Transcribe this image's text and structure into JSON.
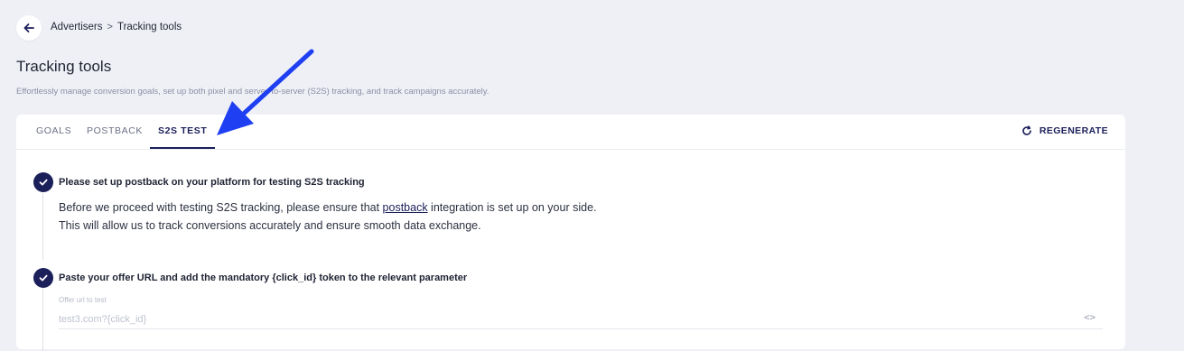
{
  "breadcrumb": {
    "parent": "Advertisers",
    "separator": ">",
    "current": "Tracking tools"
  },
  "page": {
    "title": "Tracking tools",
    "subtitle": "Effortlessly manage conversion goals, set up both pixel and server-to-server (S2S) tracking, and track campaigns accurately."
  },
  "tabs": [
    {
      "label": "GOALS",
      "active": false
    },
    {
      "label": "POSTBACK",
      "active": false
    },
    {
      "label": "S2S TEST",
      "active": true
    }
  ],
  "regenerate_label": "REGENERATE",
  "steps": [
    {
      "title": "Please set up postback on your platform for testing S2S tracking",
      "body_before_link": "Before we proceed with testing S2S tracking, please ensure that ",
      "link_text": "postback",
      "body_after_link": " integration is set up on your side.",
      "body_line2": "This will allow us to track conversions accurately and ensure smooth data exchange."
    },
    {
      "title": "Paste your offer URL and add the mandatory {click_id} token to the relevant parameter",
      "field_label": "Offer url to test",
      "field_placeholder": "test3.com?{click_id}"
    }
  ],
  "colors": {
    "accent": "#1b1f5a",
    "background": "#eff0f6",
    "annotation_arrow": "#1f3ff2"
  },
  "icons": {
    "back": "arrow-left-icon",
    "regenerate": "refresh-icon",
    "check": "check-icon",
    "code": "code-icon"
  }
}
